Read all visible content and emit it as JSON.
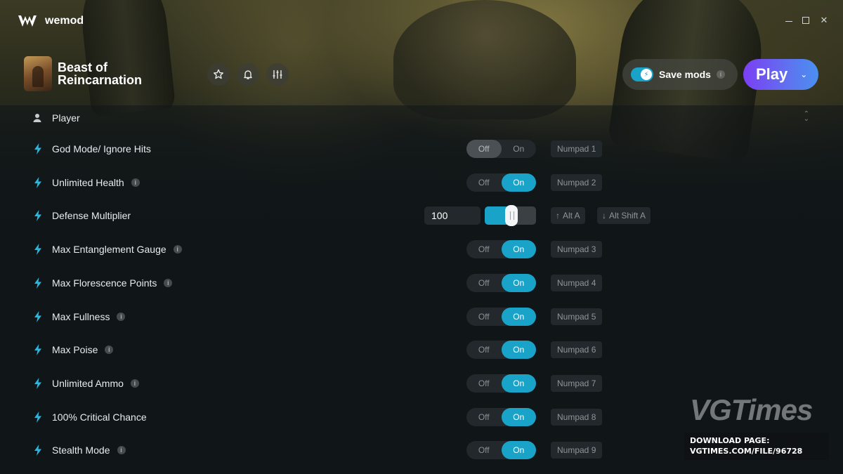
{
  "app": {
    "name": "wemod"
  },
  "game": {
    "title": "Beast of Reincarnation"
  },
  "header": {
    "save_mods_label": "Save mods",
    "info_glyph": "i",
    "play_label": "Play"
  },
  "section": {
    "title": "Player"
  },
  "toggle_labels": {
    "off": "Off",
    "on": "On"
  },
  "mods": [
    {
      "name": "God Mode/ Ignore Hits",
      "has_info": false,
      "state": "off",
      "hotkey": "Numpad 1"
    },
    {
      "name": "Unlimited Health",
      "has_info": true,
      "state": "on",
      "hotkey": "Numpad 2"
    },
    {
      "name": "Defense Multiplier",
      "has_info": false,
      "type": "slider",
      "value": "100",
      "slider_fraction": 0.52,
      "hotkey_up": "Alt A",
      "hotkey_down": "Alt Shift A"
    },
    {
      "name": "Max Entanglement Gauge",
      "has_info": true,
      "state": "on",
      "hotkey": "Numpad 3"
    },
    {
      "name": "Max Florescence Points",
      "has_info": true,
      "state": "on",
      "hotkey": "Numpad 4"
    },
    {
      "name": "Max Fullness",
      "has_info": true,
      "state": "on",
      "hotkey": "Numpad 5"
    },
    {
      "name": "Max Poise",
      "has_info": true,
      "state": "on",
      "hotkey": "Numpad 6"
    },
    {
      "name": "Unlimited Ammo",
      "has_info": true,
      "state": "on",
      "hotkey": "Numpad 7"
    },
    {
      "name": "100% Critical Chance",
      "has_info": false,
      "state": "on",
      "hotkey": "Numpad 8"
    },
    {
      "name": "Stealth Mode",
      "has_info": true,
      "state": "on",
      "hotkey": "Numpad 9"
    }
  ],
  "watermark": {
    "logo": "VGTimes",
    "line1": "DOWNLOAD PAGE:",
    "line2": "VGTIMES.COM/FILE/96728"
  },
  "colors": {
    "accent": "#1aa3c8",
    "play_start": "#7b3ff2",
    "play_end": "#4a8ff0",
    "bolt": "#2fb6e0"
  }
}
